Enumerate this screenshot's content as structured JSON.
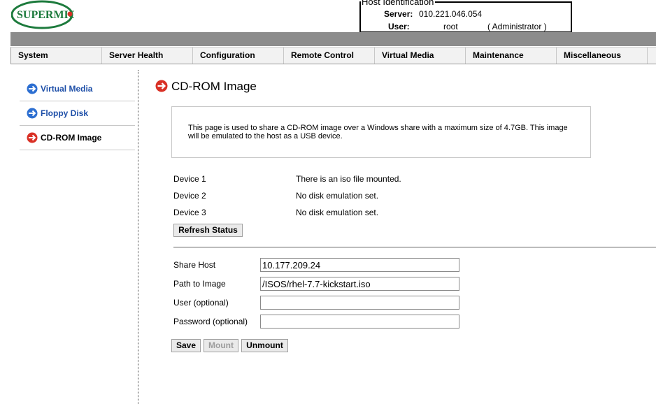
{
  "logo": {
    "text": "SUPERMICR"
  },
  "host": {
    "legend": "Host Identification",
    "server_label": "Server:",
    "server_value": "010.221.046.054",
    "user_label": "User:",
    "user_value": "root",
    "user_role": "( Administrator )"
  },
  "nav": [
    "System",
    "Server Health",
    "Configuration",
    "Remote Control",
    "Virtual Media",
    "Maintenance",
    "Miscellaneous"
  ],
  "sidebar": [
    {
      "label": "Virtual Media",
      "icon": "blue-arrow-icon"
    },
    {
      "label": "Floppy Disk",
      "icon": "blue-arrow-icon"
    },
    {
      "label": "CD-ROM Image",
      "icon": "red-arrow-icon"
    }
  ],
  "page": {
    "title": "CD-ROM Image",
    "info": "This page is used to share a CD-ROM image over a Windows share with a maximum size of 4.7GB. This image will be emulated to the host as a USB device."
  },
  "devices": [
    {
      "label": "Device 1",
      "status": "There is an iso file mounted."
    },
    {
      "label": "Device 2",
      "status": "No disk emulation set."
    },
    {
      "label": "Device 3",
      "status": "No disk emulation set."
    }
  ],
  "buttons": {
    "refresh": "Refresh Status",
    "save": "Save",
    "mount": "Mount",
    "unmount": "Unmount"
  },
  "form": {
    "share_host_label": "Share Host",
    "share_host_value": "10.177.209.24",
    "path_label": "Path to Image",
    "path_value": "/ISOS/rhel-7.7-kickstart.iso",
    "user_label": "User (optional)",
    "user_value": "",
    "password_label": "Password (optional)",
    "password_value": ""
  },
  "colors": {
    "nav_bar": "#8c8c8c",
    "link": "#1e4fa8",
    "brand": "#1c7a3c",
    "accent_red": "#d93025",
    "icon_blue": "#2d6fd1"
  }
}
